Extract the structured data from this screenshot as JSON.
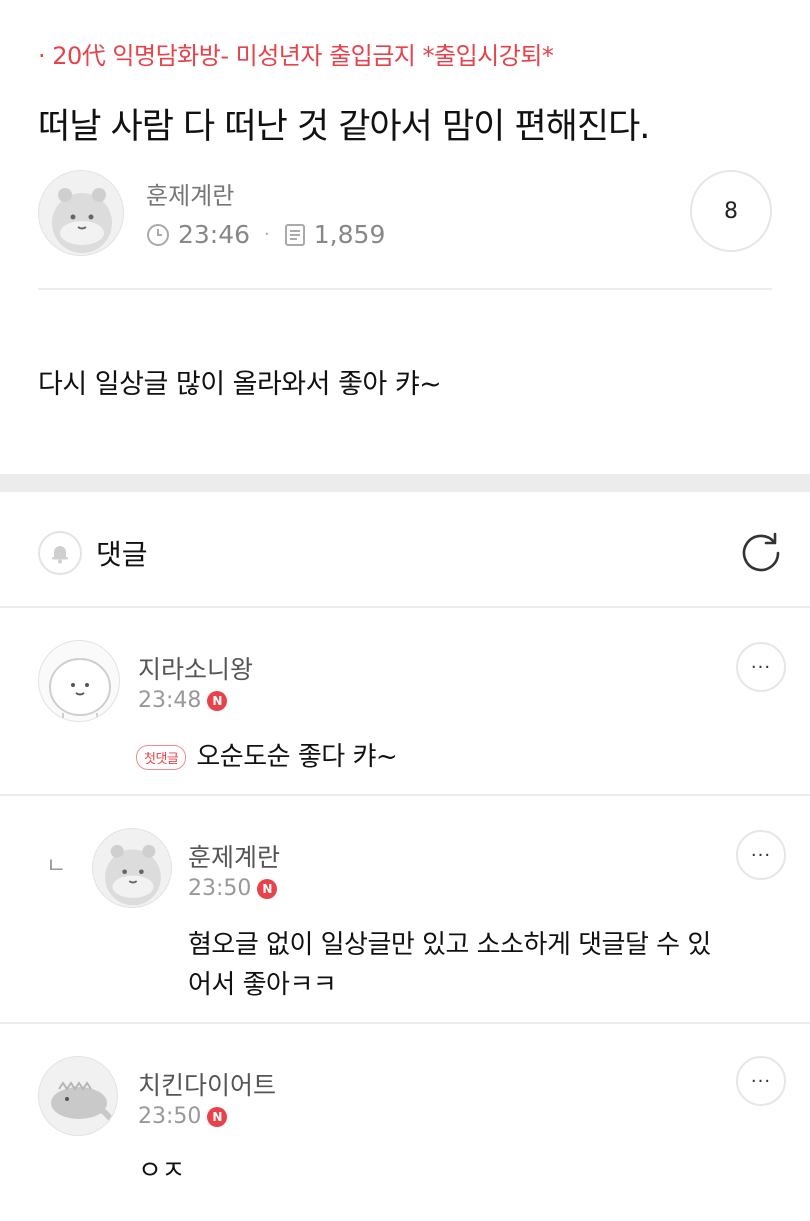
{
  "post": {
    "category": "· 20代 익명담화방- 미성년자 출입금지 *출입시강퇴*",
    "title": "떠날 사람 다 떠난 것 같아서 맘이 편해진다.",
    "author": "훈제계란",
    "time": "23:46",
    "views": "1,859",
    "comment_count": "8",
    "body": "다시 일상글 많이 올라와서 좋아 캬~"
  },
  "comments_section": {
    "label": "댓글"
  },
  "comments": [
    {
      "name": "지라소니왕",
      "time": "23:48",
      "new_badge": "N",
      "first_badge": "첫댓글",
      "text": "오순도순 좋다 캬~",
      "more": "···"
    },
    {
      "name": "훈제계란",
      "time": "23:50",
      "new_badge": "N",
      "text_line1": "혐오글 없이 일상글만 있고 소소하게 댓글달 수 있",
      "text_line2": "어서 좋아ㅋㅋ",
      "reply_mark": "ㄴ",
      "more": "···"
    },
    {
      "name": "치킨다이어트",
      "time": "23:50",
      "new_badge": "N",
      "text": "ㅇㅈ",
      "more": "···"
    }
  ],
  "colors": {
    "accent": "#e8424b",
    "divider": "#ececec"
  }
}
